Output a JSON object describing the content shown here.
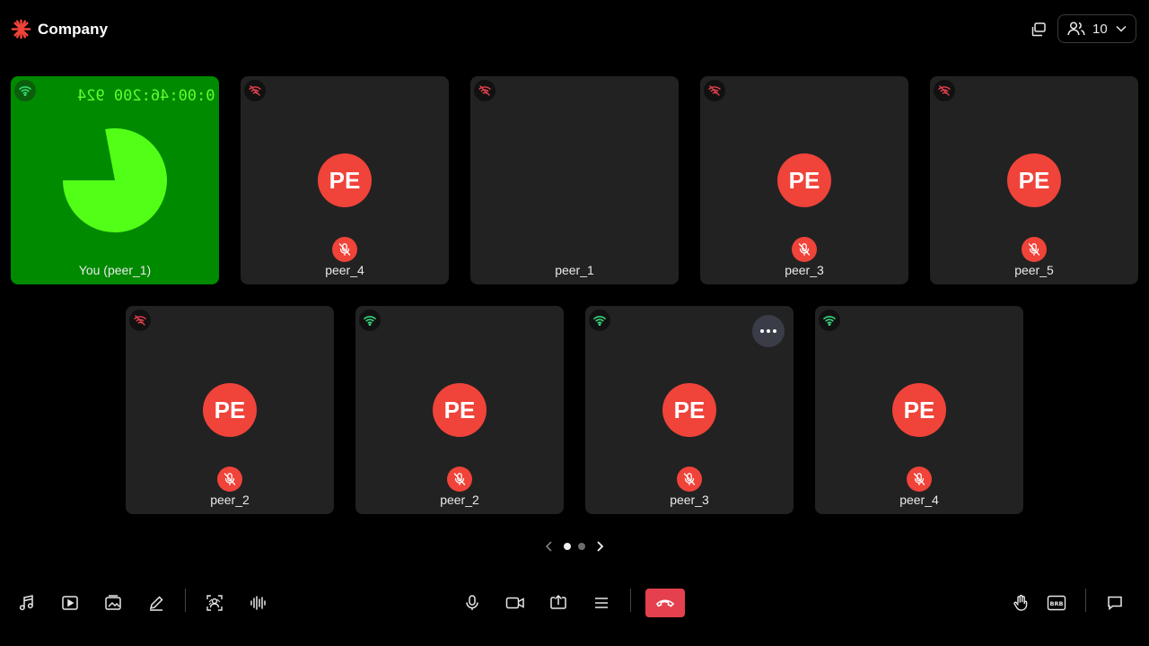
{
  "header": {
    "brand": "Company",
    "participant_count": "10"
  },
  "tiles": [
    {
      "name": "You (peer_1)",
      "network": "good",
      "self": true,
      "timecode": "0:00:46:200 924",
      "pie_fraction": 0.78
    },
    {
      "name": "peer_4",
      "network": "poor",
      "avatar": "PE",
      "muted": true
    },
    {
      "name": "peer_1",
      "network": "poor",
      "avatar": "",
      "muted": false
    },
    {
      "name": "peer_3",
      "network": "poor",
      "avatar": "PE",
      "muted": true
    },
    {
      "name": "peer_5",
      "network": "poor",
      "avatar": "PE",
      "muted": true
    },
    {
      "name": "peer_2",
      "network": "poor",
      "avatar": "PE",
      "muted": true
    },
    {
      "name": "peer_2",
      "network": "good",
      "avatar": "PE",
      "muted": true
    },
    {
      "name": "peer_3",
      "network": "good",
      "avatar": "PE",
      "muted": true,
      "menu": true
    },
    {
      "name": "peer_4",
      "network": "good",
      "avatar": "PE",
      "muted": true
    }
  ],
  "pagination": {
    "pages": 2,
    "current": 1
  },
  "colors": {
    "accent_red": "#f0433a",
    "leave_red": "#e5404d",
    "tile_bg": "#222222",
    "self_tile_bg": "#008a00",
    "network_good": "#37d67a",
    "network_poor": "#e5404d"
  },
  "toolbar": {
    "left": [
      "music-icon",
      "play-video-icon",
      "media-gallery-icon",
      "whiteboard-pen-icon",
      "virtual-background-icon",
      "audio-waveform-icon"
    ],
    "center": [
      "microphone-icon",
      "camera-icon",
      "screen-share-icon",
      "menu-icon",
      "leave-call-icon"
    ],
    "right": [
      "raise-hand-icon",
      "brb-icon",
      "chat-icon"
    ]
  }
}
